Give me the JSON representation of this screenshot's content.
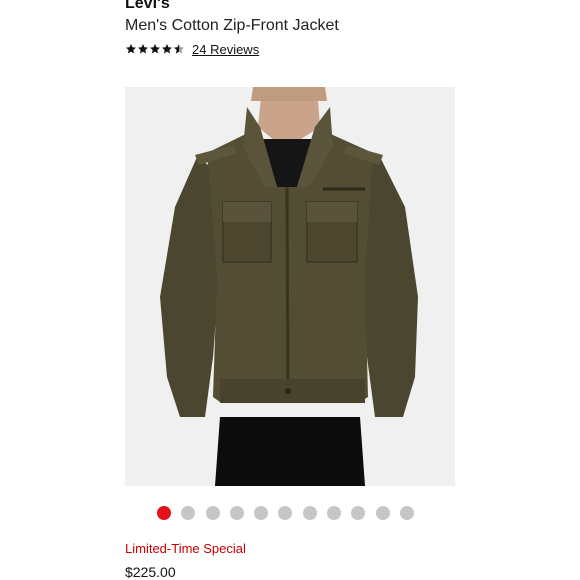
{
  "product": {
    "brand": "Levi's",
    "title": "Men's Cotton Zip-Front Jacket",
    "rating": 4.5,
    "rating_max": 5,
    "reviews_label": "24 Reviews"
  },
  "gallery": {
    "image_name": "jacket-photo",
    "image_count": 11,
    "active_index": 0,
    "colors": {
      "active_dot": "#e3131a",
      "inactive_dot": "#c6c6c6"
    }
  },
  "pricing": {
    "promo_label": "Limited-Time Special",
    "price": "$225.00",
    "promo_color": "#cc0000"
  }
}
